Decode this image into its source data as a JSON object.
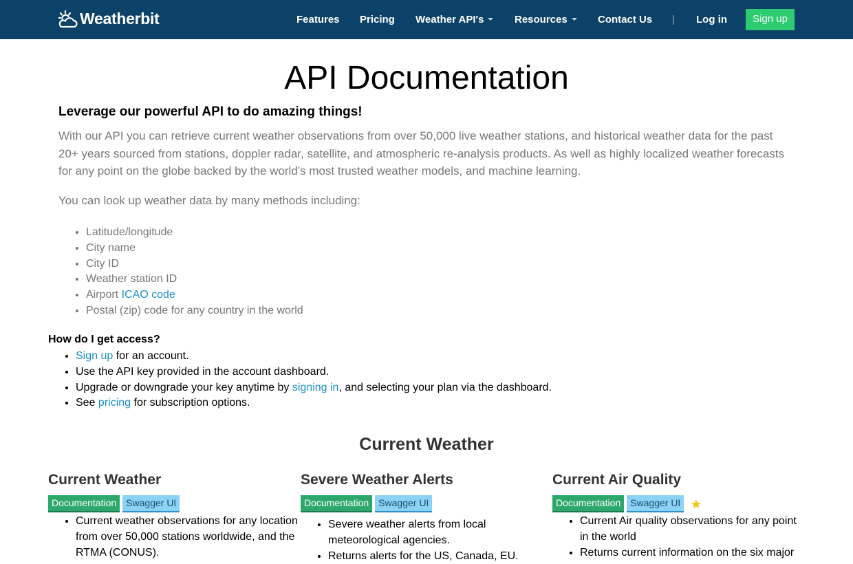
{
  "header": {
    "brand": "Weatherbit",
    "nav": [
      "Features",
      "Pricing",
      "Weather API's",
      "Resources",
      "Contact Us"
    ],
    "separator": "|",
    "login": "Log in",
    "signup": "Sign up"
  },
  "page": {
    "title": "API Documentation",
    "subtitle": "Leverage our powerful API to do amazing things!",
    "intro": "With our API you can retrieve current weather observations from over 50,000 live weather stations, and historical weather data for the past 20+ years sourced from stations, doppler radar, satellite, and atmospheric re-analysis products. As well as highly localized weather forecasts for any point on the globe backed by the world's most trusted weather models, and machine learning.",
    "methods_intro": "You can look up weather data by many methods including:",
    "methods": {
      "latlon": "Latitude/longitude",
      "city_name": "City name",
      "city_id": "City ID",
      "station_id": "Weather station ID",
      "airport_prefix": "Airport ",
      "airport_link": "ICAO code",
      "postal": "Postal (zip) code for any country in the world"
    }
  },
  "access": {
    "heading": "How do I get access?",
    "item1_link": "Sign up",
    "item1_rest": " for an account.",
    "item2": "Use the API key provided in the account dashboard.",
    "item3_pre": "Upgrade or downgrade your key anytime by ",
    "item3_link": "signing in",
    "item3_post": ", and selecting your plan via the dashboard.",
    "item4_pre": "See ",
    "item4_link": "pricing",
    "item4_post": " for subscription options."
  },
  "section": {
    "title": "Current Weather",
    "cards": [
      {
        "title": "Current Weather",
        "doc": "Documentation",
        "swagger": "Swagger UI",
        "items": [
          "Current weather observations for any location from over 50,000 stations worldwide, and the RTMA (CONUS)."
        ]
      },
      {
        "title": "Severe Weather Alerts",
        "doc": "Documentation",
        "swagger": "Swagger UI",
        "items": [
          "Severe weather alerts from local meteorological agencies.",
          "Returns alerts for the US, Canada, EU."
        ]
      },
      {
        "title": "Current Air Quality",
        "doc": "Documentation",
        "swagger": "Swagger UI",
        "items": [
          "Current Air quality observations for any point in the world",
          "Returns current information on the six major"
        ]
      }
    ]
  },
  "icons": {
    "brand": "sun-cloud-icon",
    "star": "star-icon"
  },
  "colors": {
    "navbar": "#0d4268",
    "signup": "#2ecc71",
    "link": "#1a8fc9",
    "doc_badge": "#2ea86a",
    "swagger_badge": "#8bd3f5",
    "star": "#f5c518"
  }
}
